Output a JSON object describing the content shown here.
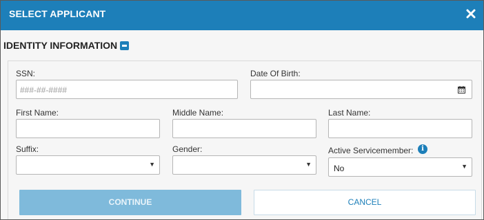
{
  "dialog": {
    "title": "SELECT APPLICANT",
    "close_icon": "close-icon"
  },
  "section": {
    "title": "IDENTITY INFORMATION",
    "toggle_icon": "collapse-minus-icon"
  },
  "fields": {
    "ssn": {
      "label": "SSN:",
      "placeholder": "###-##-####",
      "value": ""
    },
    "dob": {
      "label": "Date Of Birth:",
      "value": "",
      "icon": "calendar-icon"
    },
    "first_name": {
      "label": "First Name:",
      "value": ""
    },
    "middle_name": {
      "label": "Middle Name:",
      "value": ""
    },
    "last_name": {
      "label": "Last Name:",
      "value": ""
    },
    "suffix": {
      "label": "Suffix:",
      "value": ""
    },
    "gender": {
      "label": "Gender:",
      "value": ""
    },
    "active_servicemember": {
      "label": "Active Servicemember:",
      "value": "No",
      "info_icon": "info-icon"
    }
  },
  "buttons": {
    "continue": "CONTINUE",
    "cancel": "CANCEL"
  },
  "colors": {
    "primary": "#1d7fb9",
    "continue_disabled": "#7fbadb"
  }
}
